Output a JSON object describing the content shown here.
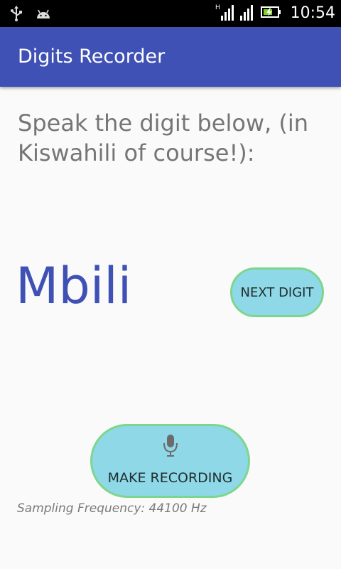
{
  "status_bar": {
    "icons": [
      "usb-icon",
      "android-icon",
      "signal-h-icon",
      "signal-icon",
      "battery-charging-icon"
    ],
    "network_type": "H",
    "time": "10:54"
  },
  "app_bar": {
    "title": "Digits Recorder",
    "color": "#3f51b5"
  },
  "main": {
    "prompt": "Speak the digit below, (in Kiswahili of course!):",
    "digit_word": "Mbili",
    "next_digit_label": "NEXT DIGIT",
    "record_icon": "microphone-icon",
    "make_recording_label": "MAKE RECORDING",
    "sampling_frequency": "Sampling Frequency: 44100 Hz"
  },
  "colors": {
    "primary": "#3f51b5",
    "button_fill": "#8fd8e8",
    "button_border": "#7ed68e",
    "text_secondary": "#757575"
  }
}
